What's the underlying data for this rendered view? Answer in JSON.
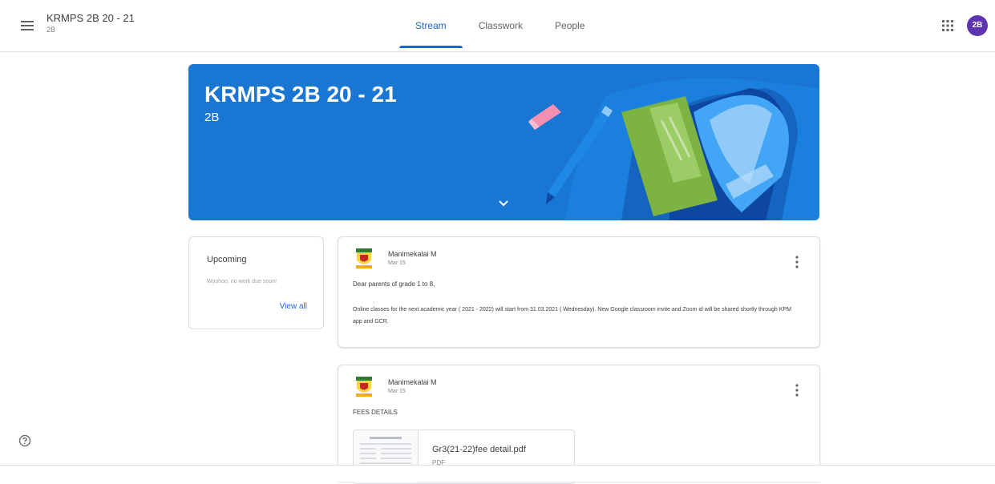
{
  "header": {
    "class_title": "KRMPS 2B 20 - 21",
    "class_subtitle": "2B",
    "tabs": [
      {
        "label": "Stream",
        "active": true
      },
      {
        "label": "Classwork",
        "active": false
      },
      {
        "label": "People",
        "active": false
      }
    ],
    "avatar_initials": "2B",
    "icons": {
      "menu": "hamburger-menu-icon",
      "apps": "apps-grid-icon"
    }
  },
  "banner": {
    "title": "KRMPS 2B 20 - 21",
    "section": "2B",
    "color": "#1976d2"
  },
  "upcoming": {
    "title": "Upcoming",
    "text": "Woohoo, no work due soon!",
    "view_all": "View all"
  },
  "posts": [
    {
      "author": "Manimekalai M",
      "date": "Mar 15",
      "line1": "Dear parents of grade 1 to 8,",
      "body": "Online classes for the next academic year ( 2021 - 2022) will start from 31.03.2021 ( Wednesday). New Google classroom invite and Zoom id will be shared shortly through KPM app and GCR."
    },
    {
      "author": "Manimekalai M",
      "date": "Mar 15",
      "line1": "FEES DETAILS",
      "attachment": {
        "name": "Gr3(21-22)fee detail.pdf",
        "type": "PDF"
      }
    }
  ],
  "colors": {
    "accent": "#1967d2",
    "avatar": "#5e35b1"
  }
}
